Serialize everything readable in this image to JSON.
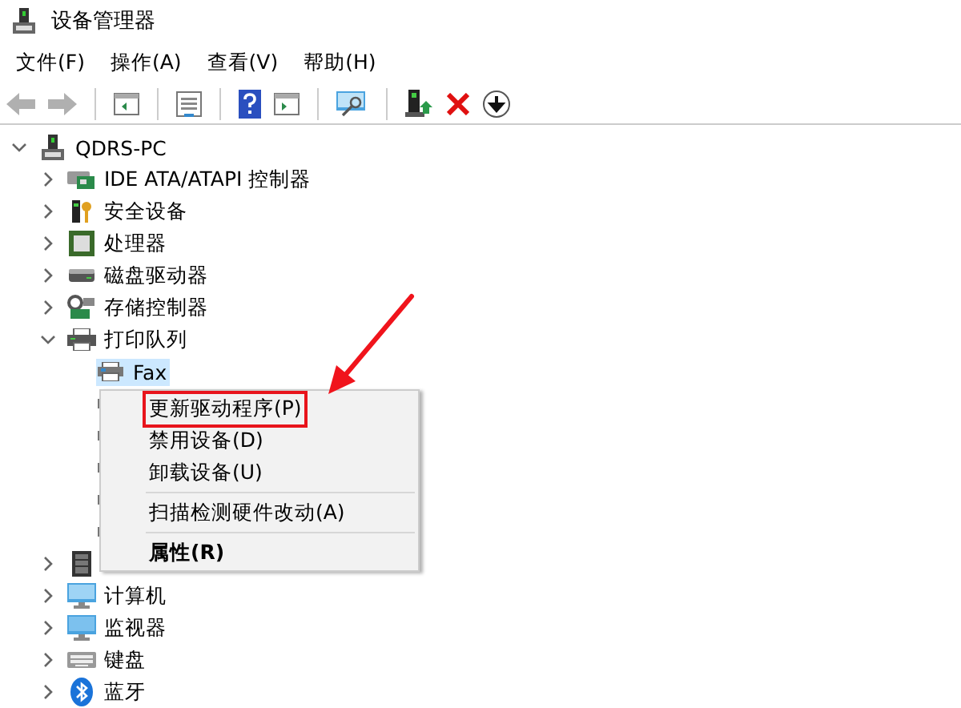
{
  "window": {
    "title": "设备管理器"
  },
  "menu_bar": [
    {
      "label": "文件(F)"
    },
    {
      "label": "操作(A)"
    },
    {
      "label": "查看(V)"
    },
    {
      "label": "帮助(H)"
    }
  ],
  "toolbar": [
    {
      "kind": "back",
      "disabled": true
    },
    {
      "kind": "forward",
      "disabled": true
    },
    {
      "kind": "separator"
    },
    {
      "kind": "console-tree",
      "disabled": false
    },
    {
      "kind": "separator"
    },
    {
      "kind": "properties",
      "disabled": false
    },
    {
      "kind": "separator"
    },
    {
      "kind": "help",
      "disabled": false
    },
    {
      "kind": "action-pane",
      "disabled": false
    },
    {
      "kind": "separator"
    },
    {
      "kind": "scan",
      "disabled": false
    },
    {
      "kind": "separator"
    },
    {
      "kind": "update-driver",
      "disabled": false
    },
    {
      "kind": "uninstall",
      "disabled": false
    },
    {
      "kind": "enable",
      "disabled": false
    }
  ],
  "tree": [
    {
      "label": "QDRS-PC",
      "kind": "computer",
      "expanded": true,
      "selected": false,
      "children": [
        {
          "label": "IDE ATA/ATAPI 控制器",
          "kind": "ide",
          "expanded": false,
          "selected": false
        },
        {
          "label": "安全设备",
          "kind": "security",
          "expanded": false,
          "selected": false
        },
        {
          "label": "处理器",
          "kind": "cpu",
          "expanded": false,
          "selected": false
        },
        {
          "label": "磁盘驱动器",
          "kind": "disk",
          "expanded": false,
          "selected": false
        },
        {
          "label": "存储控制器",
          "kind": "storage",
          "expanded": false,
          "selected": false
        },
        {
          "label": "打印队列",
          "kind": "printer",
          "expanded": true,
          "selected": false,
          "children": [
            {
              "label": "Fax",
              "kind": "fax",
              "selected": true
            },
            {
              "kind": "printer-item",
              "selected": false
            },
            {
              "kind": "printer-item",
              "selected": false
            },
            {
              "kind": "printer-item",
              "selected": false
            },
            {
              "kind": "printer-item",
              "selected": false
            },
            {
              "kind": "printer-item",
              "selected": false
            }
          ]
        },
        {
          "kind": "memory",
          "expanded": false,
          "selected": false
        },
        {
          "label": "计算机",
          "kind": "pc",
          "expanded": false,
          "selected": false
        },
        {
          "label": "监视器",
          "kind": "monitor",
          "expanded": false,
          "selected": false
        },
        {
          "label": "键盘",
          "kind": "keyboard",
          "expanded": false,
          "selected": false
        },
        {
          "label": "蓝牙",
          "kind": "bluetooth",
          "expanded": false,
          "selected": false
        }
      ]
    }
  ],
  "context_menu": [
    {
      "kind": "item",
      "label": "更新驱动程序(P)",
      "default": false,
      "annotated": true
    },
    {
      "kind": "item",
      "label": "禁用设备(D)",
      "default": false,
      "annotated": false
    },
    {
      "kind": "item",
      "label": "卸载设备(U)",
      "default": false,
      "annotated": false
    },
    {
      "kind": "separator"
    },
    {
      "kind": "item",
      "label": "扫描检测硬件改动(A)",
      "default": false,
      "annotated": false
    },
    {
      "kind": "separator"
    },
    {
      "kind": "item",
      "label": "属性(R)",
      "default": true,
      "annotated": false
    }
  ]
}
